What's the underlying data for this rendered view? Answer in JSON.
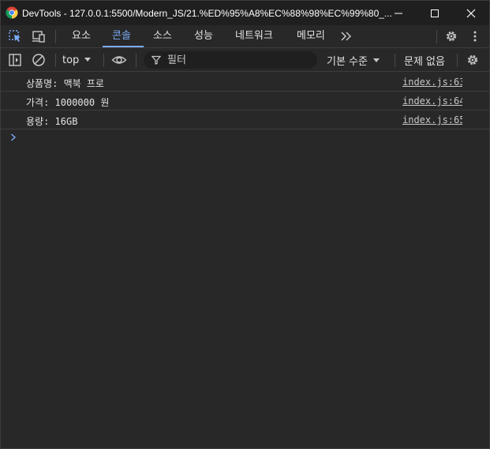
{
  "window": {
    "title": "DevTools - 127.0.0.1:5500/Modern_JS/21.%ED%95%A8%EC%88%98%EC%99%80_..."
  },
  "tabs": [
    {
      "label": "요소"
    },
    {
      "label": "콘솔"
    },
    {
      "label": "소스"
    },
    {
      "label": "성능"
    },
    {
      "label": "네트워크"
    },
    {
      "label": "메모리"
    }
  ],
  "console_toolbar": {
    "context": "top",
    "filter_placeholder": "필터",
    "level": "기본 수준",
    "issues": "문제 없음"
  },
  "messages": [
    {
      "text": "상품명: 맥북 프로",
      "source": "index.js:63"
    },
    {
      "text": "가격: 1000000 원",
      "source": "index.js:64"
    },
    {
      "text": "용량: 16GB",
      "source": "index.js:65"
    }
  ],
  "colors": {
    "accent": "#7cacf8",
    "background": "#282828",
    "titlebar": "#1f1f1f"
  }
}
